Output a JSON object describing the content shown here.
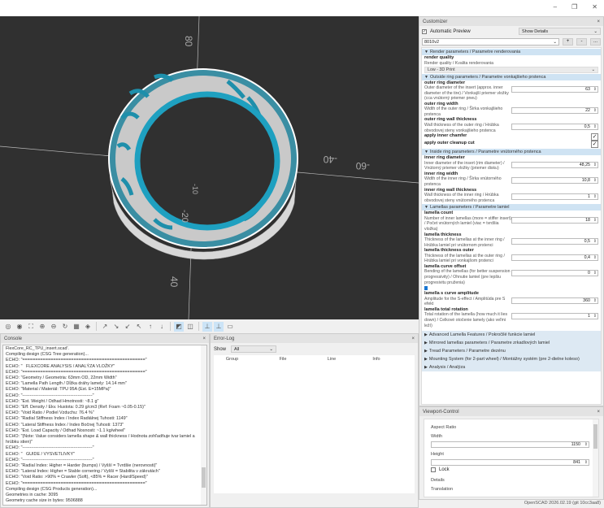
{
  "window": {
    "minimize": "–",
    "maximize": "❐",
    "close": "✕"
  },
  "viewport": {
    "axis_labels": [
      "80",
      "-40",
      "20",
      "10",
      "20",
      "-40",
      "-60",
      "40",
      "40",
      "-10",
      "-20"
    ],
    "outer_color": "#e8e8e8",
    "inner_color": "#1ea0c0"
  },
  "toolbar": {
    "icons": [
      "preview-icon",
      "render-icon",
      "view-all-icon",
      "zoom-in-icon",
      "zoom-out-icon",
      "reset-view-icon",
      "view-diagonal-icon",
      "view-center-icon",
      "view-right-icon",
      "view-top-icon",
      "view-bottom-icon",
      "view-left-icon",
      "view-front-icon",
      "view-back-icon",
      "perspective-icon",
      "orthogonal-icon",
      "show-axes-icon",
      "show-scale-icon",
      "show-edges-icon"
    ],
    "glyphs": [
      "◎",
      "◉",
      "⛶",
      "⊕",
      "⊖",
      "↻",
      "▦",
      "◈",
      "↗",
      "↘",
      "↙",
      "↖",
      "↑",
      "↓",
      "◩",
      "◫",
      "⊥",
      "⊥",
      "▭"
    ],
    "active": [
      14,
      16,
      17
    ]
  },
  "console": {
    "title": "Console",
    "close": "×",
    "lines": [
      "FlexCore_RC_TPU_insert.scad'.",
      "Compiling design (CSG Tree generation)...",
      "ECHO: \"================================================\"",
      "ECHO: \"   FLEXCORE ANALYSIS / ANALÝZA VLOŽKY\"",
      "ECHO: \"================================================\"",
      "ECHO: \"Geometry / Geometria: 63mm OD, 22mm Width\"",
      "ECHO: \"Lamella Path Length / Dĺžka dráhy lamely: 14.14 mm\"",
      "ECHO: \"Material / Materiál: TPU 95A (Est. E=15MPa)\"",
      "ECHO: \"------------------------------------------------\"",
      "ECHO: \"Est. Weight / Odhad Hmotnosti: ~8.1 g\"",
      "ECHO: \"Eff. Density / Ekv. Hustota: 0.29 g/cm3 (Ref: Foam ~0.05-0.15)\"",
      "ECHO: \"Void Ratio / Podiel Vzduchu: 76.4 %\"",
      "ECHO: \"Radial Stiffness Index / Index Radiálnej Tuhosti: 1149\"",
      "ECHO: \"Lateral Stiffness Index / Index Bočnej Tuhosti: 1373\"",
      "ECHO: \"Est. Load Capacity / Odhad Nosnosti: ~1.1 kg/wheel\"",
      "ECHO: \"(Note: Value considers lamella shape & wall thickness / Hodnota zohľadňuje tvar lamiel a hrúbku stien)\"",
      "ECHO: \"------------------------------------------------\"",
      "ECHO: \"   GUIDE / VYSVETLIVKY\"",
      "ECHO: \"------------------------------------------------\"",
      "ECHO: \"Radial Index: Higher = Harder (bumps) / Vyšší = Tvrdšie (nerovnosti)\"",
      "ECHO: \"Lateral Index: Higher = Stable cornering / Vyšší = Stabilita v zákrutách\"",
      "ECHO: \"Void Ratio: >90% = Crawler (Soft), <85% = Racer (Hard/Speed)\"",
      "ECHO: \"================================================\"",
      "Compiling design (CSG Products generation)...",
      "Geometries in cache: 3095",
      "Geometry cache size in bytes: 9506888"
    ]
  },
  "errorlog": {
    "title": "Error-Log",
    "close": "×",
    "show_label": "Show",
    "show_value": "All",
    "columns": [
      "Group",
      "File",
      "Line",
      "Info"
    ]
  },
  "customizer": {
    "title": "Customizer",
    "close": "×",
    "auto_preview_label": "Automatic Preview",
    "auto_preview": true,
    "details_value": "Show Details",
    "preset": "8010v2",
    "preset_buttons": [
      "+",
      "-",
      "..."
    ],
    "sections": [
      {
        "title": "Render parameters / Parametre renderovania",
        "params": [
          {
            "name": "render quality",
            "desc": "Render quality / Kvalita renderovania",
            "type": "select",
            "value": "Low - 3D Print"
          }
        ]
      },
      {
        "title": "Outside ring parameters / Parametre vonkajšieho prstenca",
        "params": [
          {
            "name": "outer ring diameter",
            "desc": "Outer diameter of the insert (approx. inner diameter of the tire) / Vonkajší priemer vložky (cca vnútorný priemer pneu)",
            "type": "number",
            "value": "63"
          },
          {
            "name": "outer ring width",
            "desc": "Width of the outer ring / Šírka vonkajšieho prstenca",
            "type": "number",
            "value": "22"
          },
          {
            "name": "outer ring wall thickness",
            "desc": "Wall thickness of the outer ring / Hrúbka obvodovej steny vonkajšieho prstenca",
            "type": "number",
            "value": "0,5"
          },
          {
            "name": "apply inner chamfer",
            "type": "check",
            "value": true
          },
          {
            "name": "apply outer cleanup cut",
            "type": "check",
            "value": true
          }
        ]
      },
      {
        "title": "Inside ring parameters / Parametre vnútorného prstenca",
        "params": [
          {
            "name": "inner ring diameter",
            "desc": "Inner diameter of the insert (rim diameter) / Vnútorný priemer vložky (priemer disku)",
            "type": "number",
            "value": "48,25"
          },
          {
            "name": "inner ring width",
            "desc": "Width of the inner ring / Šírka vnútorného prstenca",
            "type": "number",
            "value": "10,8"
          },
          {
            "name": "inner ring wall thickness",
            "desc": "Wall thickness of the inner ring / Hrúbka obvodovej steny vnútorného prstenca",
            "type": "number",
            "value": "1"
          }
        ]
      },
      {
        "title": "Lamellas parameters / Parametre lamiel",
        "params": [
          {
            "name": "lamella count",
            "desc": "Number of inner lamellas (more = stiffer insert) / Počet vnútorných lamiel (viac = tvrdšia vložka)",
            "type": "number",
            "value": "18"
          },
          {
            "name": "lamella thickness",
            "desc": "Thickness of the lamellas at the inner ring / Hrúbka lamiel pri vnútornom prstenci",
            "type": "number",
            "value": "0,5"
          },
          {
            "name": "lamella thickness outer",
            "desc": "Thickness of the lamellas at the outer ring / Hrúbka lamiel pri vonkajšom prstenci",
            "type": "number",
            "value": "0,4"
          },
          {
            "name": "lamella curve offset",
            "desc": "Bending of the lamellas (for better suspension progressivity) / Ohnutie lamiel (pre lepšiu progresivitu pruženia)",
            "type": "number",
            "value": "0"
          },
          {
            "name": "",
            "type": "marker"
          },
          {
            "name": "lamella s curve amplitude",
            "desc": "Amplitude for the S-effect / Amplitúda pre S efekt",
            "type": "number",
            "value": "360"
          },
          {
            "name": "lamella total rotation",
            "desc": "Total rotation of the lamella (how much it lies down) / Celkové otočenie lamely (ako veľmi leží)",
            "type": "number",
            "value": "1"
          }
        ]
      }
    ],
    "collapsed": [
      "Advanced Lamella Features / Pokročilé funkcie lamiel",
      "Mirrored lamellas parameters / Parametre zrkadlových lamiel",
      "Tread Parameters / Parametre dezénu",
      "Mounting System (for 2-part wheel) / Montážny systém (pre 2-dielne koleso)",
      "Analysis / Analýza"
    ]
  },
  "viewport_control": {
    "title": "Viewport-Control",
    "close": "×",
    "aspect_ratio": "Aspect Ratio",
    "width_label": "Width",
    "width": "1150",
    "height_label": "Height",
    "height": "841",
    "lock_label": "Lock",
    "details": "Details",
    "translation": "Translation"
  },
  "status": "OpenSCAD 2026.02.19 (git 10cc3aa8)"
}
